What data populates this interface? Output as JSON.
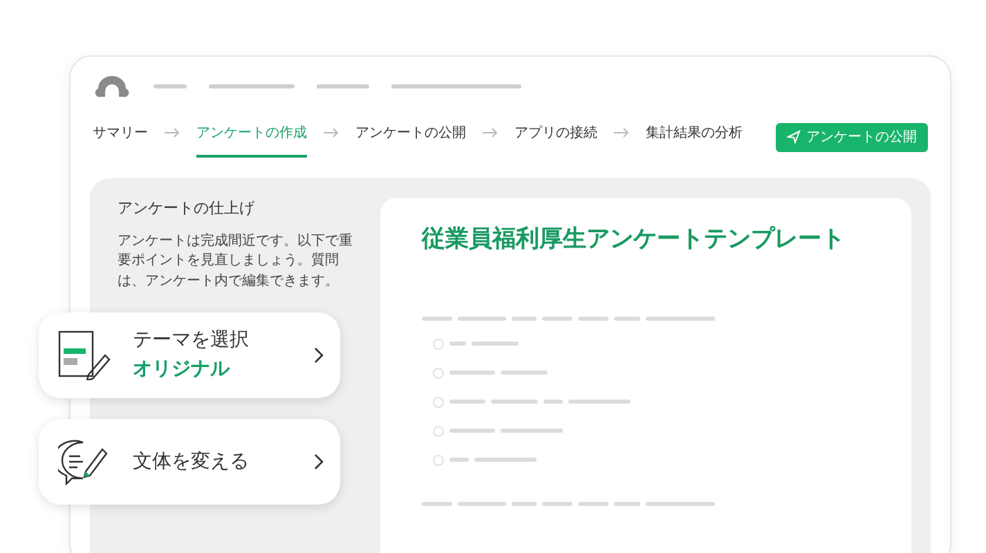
{
  "steps": [
    {
      "label": "サマリー",
      "selected": false
    },
    {
      "label": "アンケートの作成",
      "selected": true
    },
    {
      "label": "アンケートの公開",
      "selected": false
    },
    {
      "label": "アプリの接続",
      "selected": false
    },
    {
      "label": "集計結果の分析",
      "selected": false
    }
  ],
  "publish_button": {
    "label": "アンケートの公開"
  },
  "panel": {
    "title": "アンケートの仕上げ",
    "description": "アンケートは完成間近です。以下で重要ポイントを見直しましょう。質問は、アンケート内で編集できます。"
  },
  "survey": {
    "title": "従業員福利厚生アンケートテンプレート",
    "options": [
      {
        "selected": false
      },
      {
        "selected": false
      },
      {
        "selected": false
      },
      {
        "selected": false
      },
      {
        "selected": false
      }
    ]
  },
  "option_cards": [
    {
      "kind": "theme",
      "title": "テーマを選択",
      "value": "オリジナル"
    },
    {
      "kind": "style",
      "title": "文体を変える"
    }
  ]
}
